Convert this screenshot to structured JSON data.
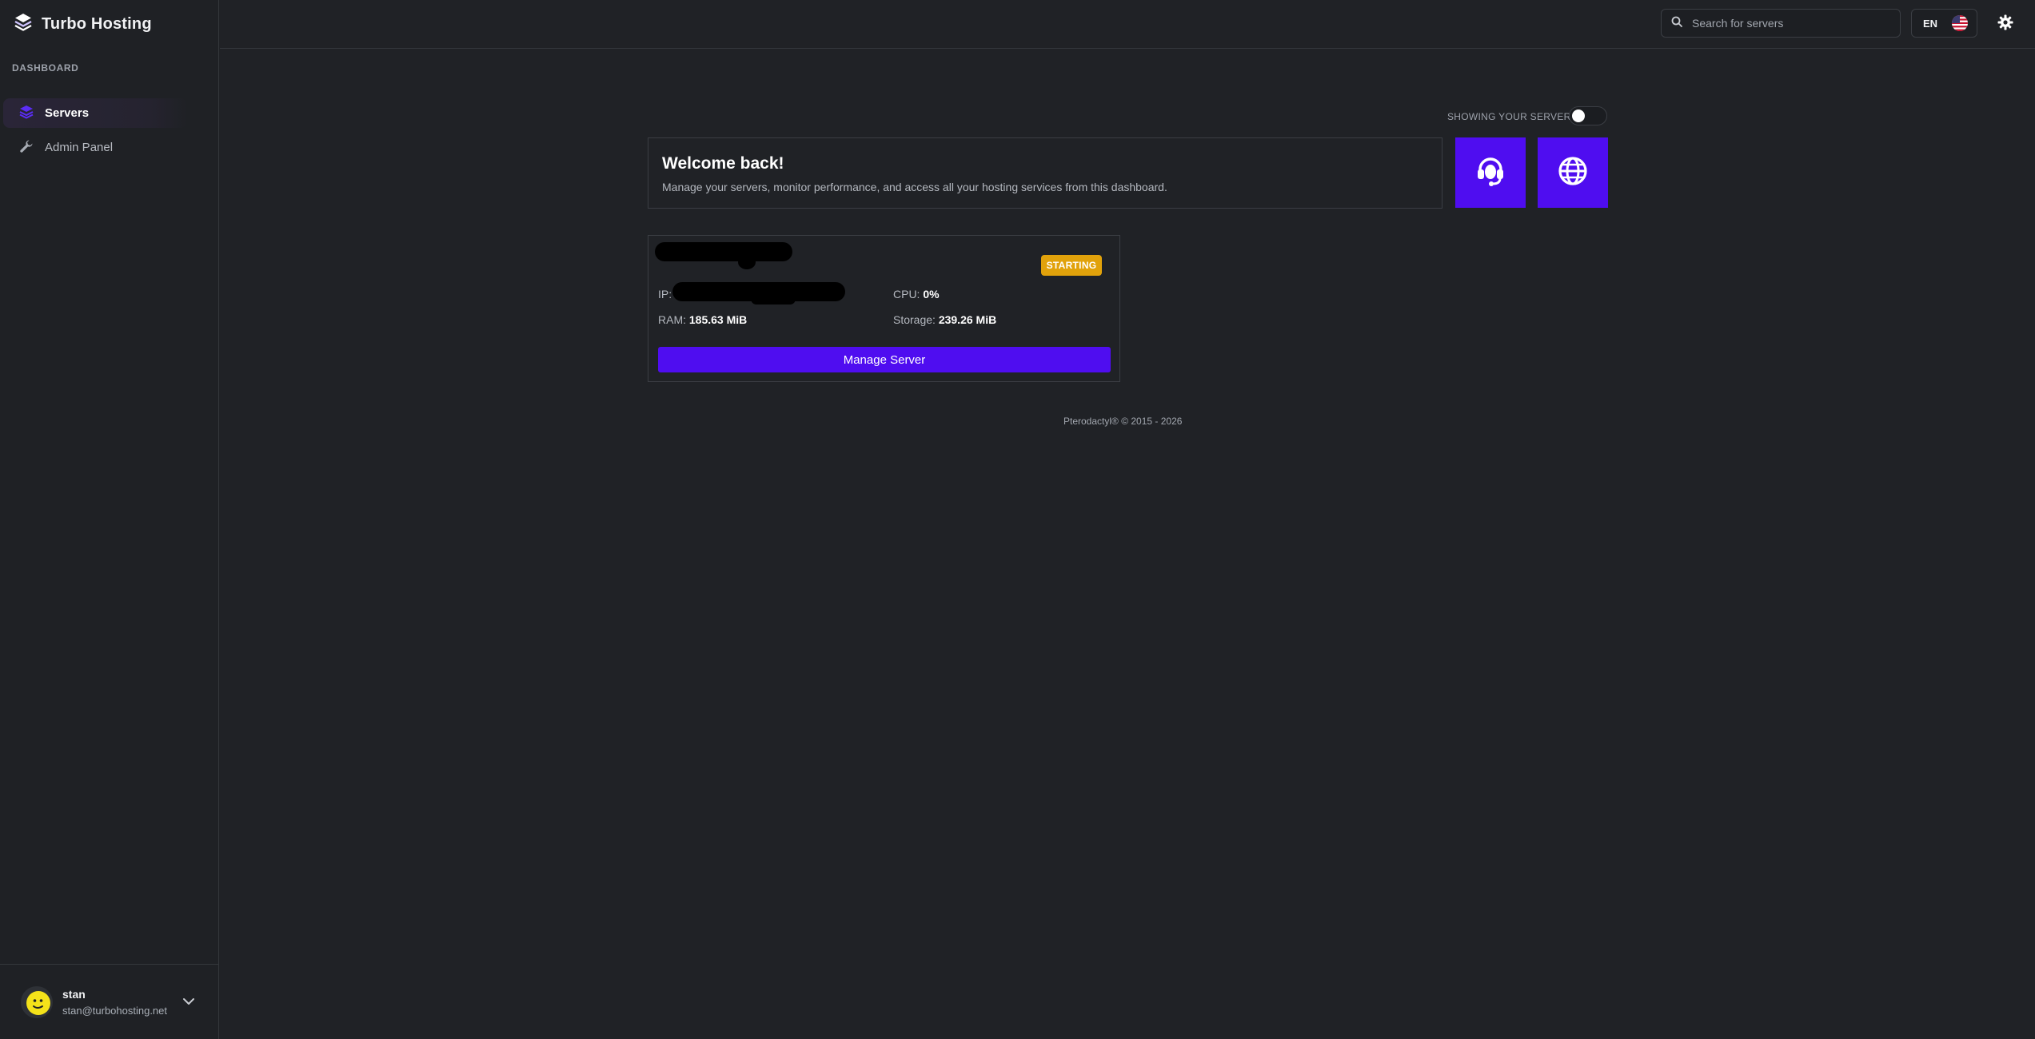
{
  "brand": {
    "title": "Turbo Hosting",
    "icon": "layers-logo-icon"
  },
  "sidebar": {
    "section_label": "DASHBOARD",
    "items": [
      {
        "label": "Servers",
        "icon": "stack-icon",
        "active": true
      },
      {
        "label": "Admin Panel",
        "icon": "wrench-icon",
        "active": false
      }
    ]
  },
  "user": {
    "name": "stan",
    "email": "stan@turbohosting.net"
  },
  "topbar": {
    "search_placeholder": "Search for servers",
    "language": "EN"
  },
  "main": {
    "toggle_label": "SHOWING YOUR SERVERS",
    "toggle_on": false,
    "welcome": {
      "title": "Welcome back!",
      "subtitle": "Manage your servers, monitor performance, and access all your hosting services from this dashboard."
    },
    "quick_links": [
      {
        "icon": "headset-support-icon"
      },
      {
        "icon": "globe-icon"
      }
    ],
    "servers": [
      {
        "status": "STARTING",
        "ip_label": "IP:",
        "cpu_label": "CPU:",
        "cpu_value": "0%",
        "ram_label": "RAM:",
        "ram_value": "185.63 MiB",
        "storage_label": "Storage:",
        "storage_value": "239.26 MiB",
        "action_label": "Manage Server"
      }
    ]
  },
  "footer": {
    "text": "Pterodactyl® © 2015 - 2026"
  },
  "colors": {
    "background": "#202226",
    "accent": "#4f0df0",
    "status_starting": "#e1a20b",
    "border": "#3b3e44"
  }
}
